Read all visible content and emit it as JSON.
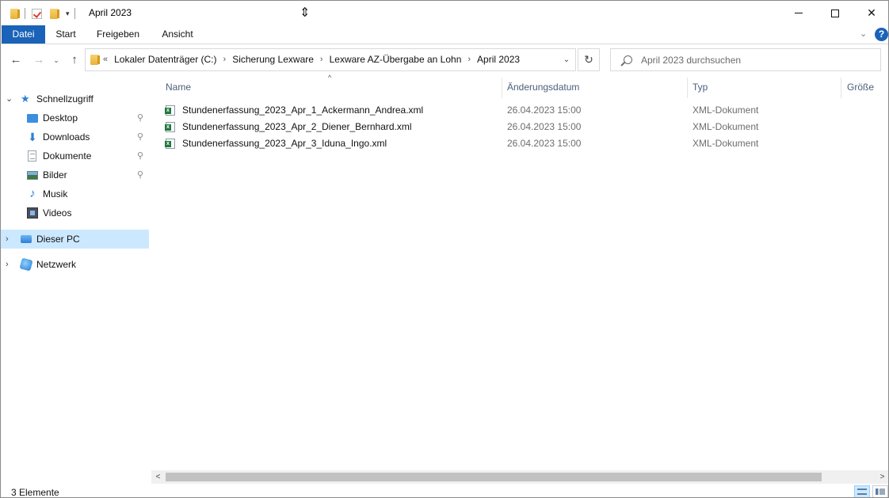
{
  "window": {
    "title": "April 2023",
    "controls": {
      "minimize": "—",
      "maximize": "☐",
      "close": "✕"
    }
  },
  "ribbon": {
    "tabs": [
      "Datei",
      "Start",
      "Freigeben",
      "Ansicht"
    ],
    "expand": "⌄",
    "help": "?"
  },
  "nav": {
    "back": "←",
    "forward": "→",
    "recent": "⌄",
    "up": "↑",
    "refresh": "↻"
  },
  "address": {
    "overflow": "«",
    "crumbs": [
      "Lokaler Datenträger (C:)",
      "Sicherung Lexware",
      "Lexware AZ-Übergabe an Lohn",
      "April 2023"
    ],
    "separator": "›",
    "dropdown": "⌄"
  },
  "search": {
    "placeholder": "April 2023 durchsuchen",
    "value": ""
  },
  "sidebar": {
    "items": [
      {
        "label": "Schnellzugriff",
        "icon": "star-icon",
        "expander": "⌄",
        "pinned": false
      },
      {
        "label": "Desktop",
        "icon": "desktop-icon",
        "pinned": true
      },
      {
        "label": "Downloads",
        "icon": "download-icon",
        "pinned": true
      },
      {
        "label": "Dokumente",
        "icon": "documents-icon",
        "pinned": true
      },
      {
        "label": "Bilder",
        "icon": "pictures-icon",
        "pinned": true
      },
      {
        "label": "Musik",
        "icon": "music-icon",
        "pinned": false
      },
      {
        "label": "Videos",
        "icon": "videos-icon",
        "pinned": false
      },
      {
        "label": "Dieser PC",
        "icon": "computer-icon",
        "expander": "›",
        "selected": true
      },
      {
        "label": "Netzwerk",
        "icon": "network-icon",
        "expander": "›"
      }
    ],
    "pin_glyph": "📌"
  },
  "columns": [
    "Name",
    "Änderungsdatum",
    "Typ",
    "Größe"
  ],
  "sort_indicator": "^",
  "files": [
    {
      "name": "Stundenerfassung_2023_Apr_1_Ackermann_Andrea.xml",
      "date": "26.04.2023 15:00",
      "type": "XML-Dokument"
    },
    {
      "name": "Stundenerfassung_2023_Apr_2_Diener_Bernhard.xml",
      "date": "26.04.2023 15:00",
      "type": "XML-Dokument"
    },
    {
      "name": "Stundenerfassung_2023_Apr_3_Iduna_Ingo.xml",
      "date": "26.04.2023 15:00",
      "type": "XML-Dokument"
    }
  ],
  "scrollbar": {
    "left": "<",
    "right": ">"
  },
  "status": {
    "text": "3 Elemente"
  }
}
